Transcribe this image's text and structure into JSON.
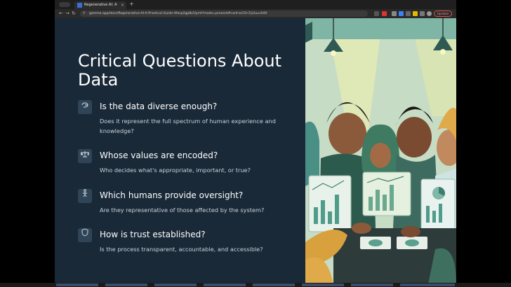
{
  "browser": {
    "tab_title": "Regenerative AI: A Practical",
    "url": "gamma.app/docs/Regenerative-AI-A-Practical-Guide-4fasp2gp8z1lymt?mode=present#card-zz15n7js2uuv040",
    "update_label": "Update"
  },
  "slide": {
    "heading": "Critical Questions About Data",
    "questions": [
      {
        "icon": "brain-icon",
        "title": "Is the data diverse enough?",
        "desc": "Does it represent the full spectrum of human experience and knowledge?"
      },
      {
        "icon": "scale-icon",
        "title": "Whose values are encoded?",
        "desc": "Who decides what's appropriate, important, or true?"
      },
      {
        "icon": "person-icon",
        "title": "Which humans provide oversight?",
        "desc": "Are they representative of those affected by the system?"
      },
      {
        "icon": "shield-icon",
        "title": "How is trust established?",
        "desc": "Is the process transparent, accountable, and accessible?"
      }
    ]
  },
  "colors": {
    "slide_bg": "#1a2938",
    "icon_bg": "#2f4557",
    "heading": "#ffffff",
    "desc": "#c9d2d9"
  }
}
